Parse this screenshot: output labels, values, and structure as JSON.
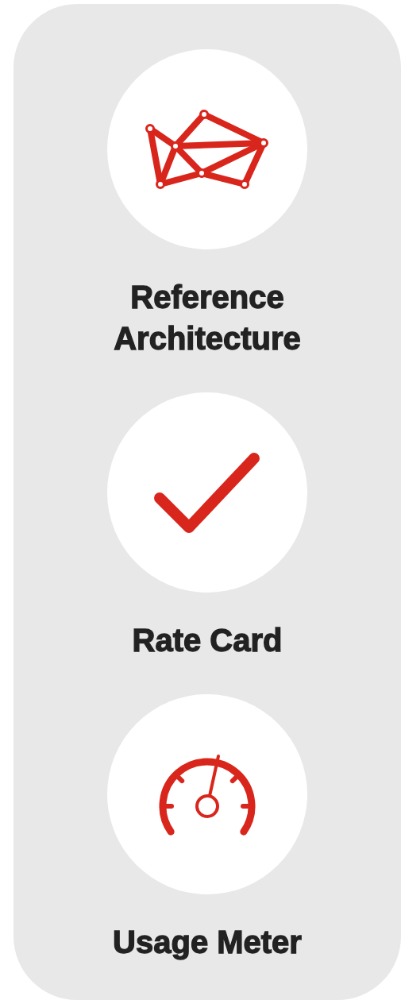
{
  "cards": [
    {
      "label": "Reference Architecture",
      "kind": "network"
    },
    {
      "label": "Rate Card",
      "kind": "check"
    },
    {
      "label": "Usage Meter",
      "kind": "gauge"
    }
  ]
}
